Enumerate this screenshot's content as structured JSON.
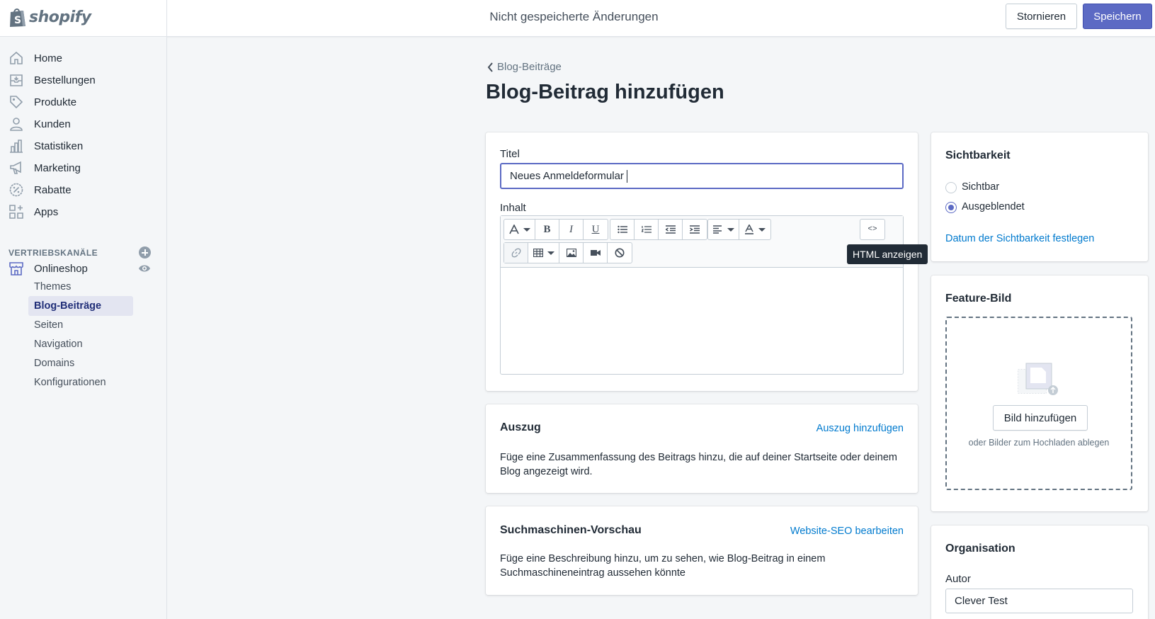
{
  "brand": {
    "name": "shopify"
  },
  "topbar": {
    "unsaved_text": "Nicht gespeicherte Änderungen",
    "cancel_label": "Stornieren",
    "save_label": "Speichern"
  },
  "sidebar": {
    "items": [
      {
        "label": "Home",
        "icon": "home-icon"
      },
      {
        "label": "Bestellungen",
        "icon": "orders-icon"
      },
      {
        "label": "Produkte",
        "icon": "tag-icon"
      },
      {
        "label": "Kunden",
        "icon": "person-icon"
      },
      {
        "label": "Statistiken",
        "icon": "bar-chart-icon"
      },
      {
        "label": "Marketing",
        "icon": "megaphone-icon"
      },
      {
        "label": "Rabatte",
        "icon": "discount-icon"
      },
      {
        "label": "Apps",
        "icon": "apps-icon"
      }
    ],
    "channels_label": "VERTRIEBSKANÄLE",
    "online_store": {
      "label": "Onlineshop",
      "icon": "store-icon"
    },
    "sub_items": [
      {
        "label": "Themes",
        "active": false
      },
      {
        "label": "Blog-Beiträge",
        "active": true
      },
      {
        "label": "Seiten",
        "active": false
      },
      {
        "label": "Navigation",
        "active": false
      },
      {
        "label": "Domains",
        "active": false
      },
      {
        "label": "Konfigurationen",
        "active": false
      }
    ]
  },
  "page": {
    "breadcrumb": "Blog-Beiträge",
    "title": "Blog-Beitrag hinzufügen"
  },
  "post_form": {
    "title_label": "Titel",
    "title_value": "Neues Anmeldeformular",
    "content_label": "Inhalt",
    "toolbar_tooltip": "HTML anzeigen",
    "code_button_label": "<>"
  },
  "excerpt": {
    "title": "Auszug",
    "link": "Auszug hinzufügen",
    "text": "Füge eine Zusammenfassung des Beitrags hinzu, die auf deiner Startseite oder deinem Blog angezeigt wird."
  },
  "seo": {
    "title": "Suchmaschinen-Vorschau",
    "link": "Website-SEO bearbeiten",
    "text": "Füge eine Beschreibung hinzu, um zu sehen, wie Blog-Beitrag in einem Suchmaschineneintrag aussehen könnte"
  },
  "visibility": {
    "title": "Sichtbarkeit",
    "options": [
      {
        "label": "Sichtbar",
        "checked": false
      },
      {
        "label": "Ausgeblendet",
        "checked": true
      }
    ],
    "date_link": "Datum der Sichtbarkeit festlegen"
  },
  "feature_image": {
    "title": "Feature-Bild",
    "button": "Bild hinzufügen",
    "hint": "oder Bilder zum Hochladen ablegen"
  },
  "organisation": {
    "title": "Organisation",
    "author_label": "Autor",
    "author_value": "Clever Test"
  },
  "colors": {
    "accent": "#5c6ac4",
    "link": "#007ace",
    "sidebar_active_bg": "#e3e5f1"
  }
}
